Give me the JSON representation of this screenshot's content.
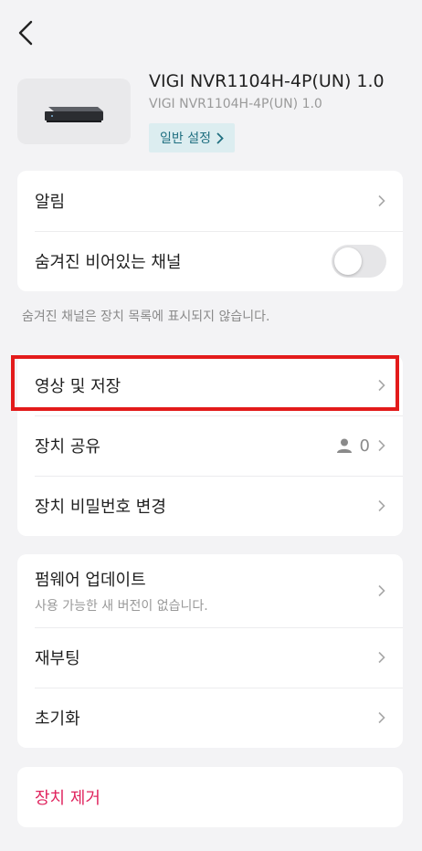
{
  "device": {
    "title": "VIGI NVR1104H-4P(UN) 1.0",
    "subtitle": "VIGI NVR1104H-4P(UN) 1.0",
    "general_settings_label": "일반 설정"
  },
  "group1": {
    "notifications_label": "알림",
    "hidden_channels_label": "숨겨진 비어있는 채널",
    "hidden_channels_enabled": false,
    "hint": "숨겨진 채널은 장치 목록에 표시되지 않습니다."
  },
  "group2": {
    "video_storage_label": "영상 및 저장",
    "device_share_label": "장치 공유",
    "device_share_count": "0",
    "change_password_label": "장치 비밀번호 변경"
  },
  "group3": {
    "firmware_label": "펌웨어 업데이트",
    "firmware_status": "사용 가능한 새 버전이 없습니다.",
    "reboot_label": "재부팅",
    "reset_label": "초기화"
  },
  "remove_label": "장치 제거",
  "colors": {
    "accent_bg": "#dcedf0",
    "accent_text": "#1f6f80",
    "danger": "#e0245e",
    "highlight": "#e31b1b"
  }
}
